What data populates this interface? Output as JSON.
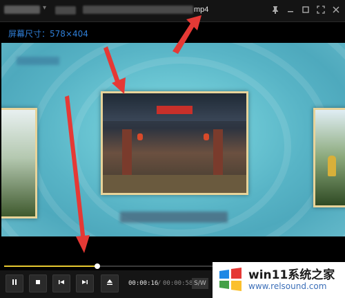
{
  "titlebar": {
    "title_suffix": "mp4",
    "dropdown_icon": "chevron-down-icon",
    "buttons": [
      "pin-icon",
      "minimize-icon",
      "maximize-icon",
      "fullscreen-icon",
      "close-icon"
    ]
  },
  "overlay": {
    "screen_size": "屏幕尺寸：578×404"
  },
  "player": {
    "progress": 0.2759,
    "time_current": "00:00:16",
    "time_separator": "/",
    "time_total": "00:00:58",
    "speed_label": "S/W",
    "controls": [
      "pause-icon",
      "stop-icon",
      "previous-icon",
      "next-icon",
      "eject-icon"
    ]
  },
  "brand": {
    "name": "win11系统之家",
    "url": "www.relsound.com"
  },
  "colors": {
    "accent": "#e8c930",
    "annotation_arrow": "#e53935",
    "screen_size_text": "#2f7fd8"
  }
}
